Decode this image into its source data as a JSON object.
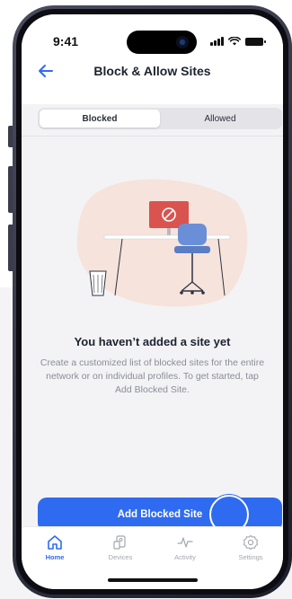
{
  "status_bar": {
    "time": "9:41"
  },
  "header": {
    "title": "Block & Allow Sites"
  },
  "segments": [
    {
      "label": "Blocked",
      "active": true
    },
    {
      "label": "Allowed",
      "active": false
    }
  ],
  "empty_state": {
    "title": "You haven’t added a site yet",
    "description": "Create a customized list of blocked sites for the entire network or on individual profiles. To get started, tap Add Blocked Site."
  },
  "cta": {
    "label": "Add Blocked Site"
  },
  "tabs": [
    {
      "label": "Home",
      "icon": "home-icon",
      "active": true
    },
    {
      "label": "Devices",
      "icon": "devices-icon",
      "active": false
    },
    {
      "label": "Activity",
      "icon": "activity-icon",
      "active": false
    },
    {
      "label": "Settings",
      "icon": "settings-icon",
      "active": false
    }
  ],
  "colors": {
    "accent": "#2f6bf0",
    "blob": "#f6e3db",
    "monitor": "#d9534f",
    "chair": "#6b8fd6"
  }
}
